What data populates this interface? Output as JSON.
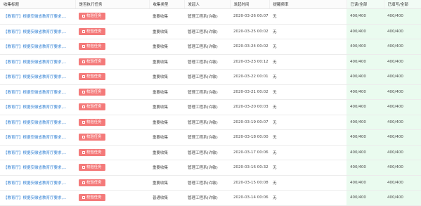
{
  "columns": [
    "收集标题",
    "是否执行任务",
    "收集类型",
    "发起人",
    "发起时间",
    "提醒频率",
    "已读/全部",
    "已填写/全部"
  ],
  "task_button_label": "校验任务",
  "rows": [
    {
      "title": "【教育厅】根据安徽省教育厅要求,...",
      "type": "重要收集",
      "initiator": "管理工程系(许敏)",
      "time": "2020-03-26 00:07",
      "freq": "无",
      "read": "400/400",
      "filled": "400/400"
    },
    {
      "title": "【教育厅】根据安徽省教育厅要求,...",
      "type": "重要收集",
      "initiator": "管理工程系(许敏)",
      "time": "2020-03-25 00:02",
      "freq": "无",
      "read": "400/400",
      "filled": "400/400"
    },
    {
      "title": "【教育厅】根据安徽省教育厅要求,...",
      "type": "重要收集",
      "initiator": "管理工程系(许敏)",
      "time": "2020-03-24 00:02",
      "freq": "无",
      "read": "400/400",
      "filled": "400/400"
    },
    {
      "title": "【教育厅】根据安徽省教育厅要求,...",
      "type": "重要收集",
      "initiator": "管理工程系(许敏)",
      "time": "2020-03-23 00:12",
      "freq": "无",
      "read": "400/400",
      "filled": "400/400"
    },
    {
      "title": "【教育厅】根据安徽省教育厅要求,...",
      "type": "重要收集",
      "initiator": "管理工程系(许敏)",
      "time": "2020-03-22 00:01",
      "freq": "无",
      "read": "400/400",
      "filled": "400/400"
    },
    {
      "title": "【教育厅】根据安徽省教育厅要求,...",
      "type": "重要收集",
      "initiator": "管理工程系(许敏)",
      "time": "2020-03-21 00:02",
      "freq": "无",
      "read": "400/400",
      "filled": "400/400"
    },
    {
      "title": "【教育厅】根据安徽省教育厅要求,...",
      "type": "重要收集",
      "initiator": "管理工程系(许敏)",
      "time": "2020-03-20 00:03",
      "freq": "无",
      "read": "400/400",
      "filled": "400/400"
    },
    {
      "title": "【教育厅】根据安徽省教育厅要求,...",
      "type": "重要收集",
      "initiator": "管理工程系(许敏)",
      "time": "2020-03-19 00:07",
      "freq": "无",
      "read": "400/400",
      "filled": "400/400"
    },
    {
      "title": "【教育厅】根据安徽省教育厅要求,...",
      "type": "重要收集",
      "initiator": "管理工程系(许敏)",
      "time": "2020-03-18 00:00",
      "freq": "无",
      "read": "400/400",
      "filled": "400/400"
    },
    {
      "title": "【教育厅】根据安徽省教育厅要求,...",
      "type": "重要收集",
      "initiator": "管理工程系(许敏)",
      "time": "2020-03-17 00:06",
      "freq": "无",
      "read": "400/400",
      "filled": "400/400"
    },
    {
      "title": "【教育厅】根据安徽省教育厅要求,...",
      "type": "重要收集",
      "initiator": "管理工程系(许敏)",
      "time": "2020-03-16 00:32",
      "freq": "无",
      "read": "400/400",
      "filled": "400/400"
    },
    {
      "title": "【教育厅】根据安徽省教育厅要求,...",
      "type": "重要收集",
      "initiator": "管理工程系(许敏)",
      "time": "2020-03-15 00:08",
      "freq": "无",
      "read": "400/400",
      "filled": "400/400"
    },
    {
      "title": "【教育厅】根据安徽省教育厅要求,...",
      "type": "普通收集",
      "initiator": "管理工程系(许敏)",
      "time": "2020-03-14 00:06",
      "freq": "无",
      "read": "400/400",
      "filled": "400/400"
    }
  ],
  "colors": {
    "title_link": "#2f7fd3",
    "task_button_bg": "#f47a7a",
    "progress_bg": "#eafbef"
  }
}
